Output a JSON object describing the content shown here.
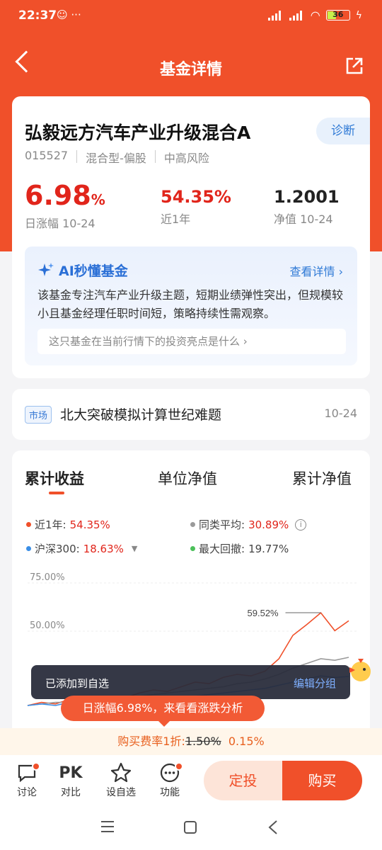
{
  "status_bar": {
    "time": "22:37",
    "battery": "36",
    "net1": "HD",
    "net2": "HD"
  },
  "nav": {
    "title": "基金详情"
  },
  "fund": {
    "name": "弘毅远方汽车产业升级混合A",
    "diagnose": "诊断",
    "code": "015527",
    "type": "混合型-偏股",
    "risk": "中高风险",
    "stats": [
      {
        "value": "6.98",
        "unit": "%",
        "label": "日涨幅 10-24"
      },
      {
        "value": "54.35%",
        "label": "近1年"
      },
      {
        "value": "1.2001",
        "label": "净值 10-24"
      }
    ]
  },
  "ai": {
    "title": "AI秒懂基金",
    "more": "查看详情",
    "text": "该基金专注汽车产业升级主题，短期业绩弹性突出，但规模较小且基金经理任职时间短，策略持续性需观察。",
    "question": "这只基金在当前行情下的投资亮点是什么"
  },
  "news": {
    "tag": "市场",
    "title": "北大突破模拟计算世纪难题",
    "date": "10-24"
  },
  "chart_tabs": [
    "累计收益",
    "单位净值",
    "累计净值"
  ],
  "legend": [
    {
      "label": "近1年:",
      "value": "54.35%",
      "color": "#f0502a"
    },
    {
      "label": "同类平均:",
      "value": "30.89%",
      "color": "#9a9a9a"
    },
    {
      "label": "沪深300:",
      "value": "18.63%",
      "color": "#3a8ee6"
    },
    {
      "label": "最大回撤:",
      "value": "19.77%",
      "color": "#4cc05a"
    }
  ],
  "chart_data": {
    "type": "line",
    "y_ticks": [
      "75.00%",
      "50.00%"
    ],
    "annotation": "59.52%",
    "series": [
      {
        "name": "近1年",
        "color": "#f0502a",
        "values": [
          0,
          2,
          1,
          4,
          3,
          5,
          6,
          5,
          8,
          10,
          9,
          12,
          15,
          14,
          18,
          20,
          19,
          22,
          30,
          45,
          52,
          59.52,
          48,
          54.35
        ]
      },
      {
        "name": "同类平均",
        "color": "#9a9a9a",
        "values": [
          0,
          1,
          2,
          2,
          3,
          4,
          5,
          6,
          6,
          7,
          8,
          9,
          10,
          11,
          12,
          14,
          15,
          17,
          20,
          24,
          27,
          30,
          29,
          30.89
        ]
      },
      {
        "name": "沪深300",
        "color": "#3a8ee6",
        "values": [
          0,
          1,
          0,
          2,
          1,
          2,
          3,
          3,
          4,
          4,
          5,
          6,
          6,
          7,
          8,
          9,
          10,
          11,
          13,
          15,
          17,
          19,
          18,
          18.63
        ]
      }
    ]
  },
  "toast": {
    "text": "已添加到自选",
    "action": "编辑分组"
  },
  "bubble": "日涨幅6.98%，来看看涨跌分析",
  "fee": {
    "prefix": "购买费率1折:",
    "old": "1.50%",
    "new": "0.15%"
  },
  "bottom": {
    "items": [
      "讨论",
      "对比",
      "设自选",
      "功能"
    ],
    "pk": "PK",
    "dingtou": "定投",
    "buy": "购买"
  }
}
